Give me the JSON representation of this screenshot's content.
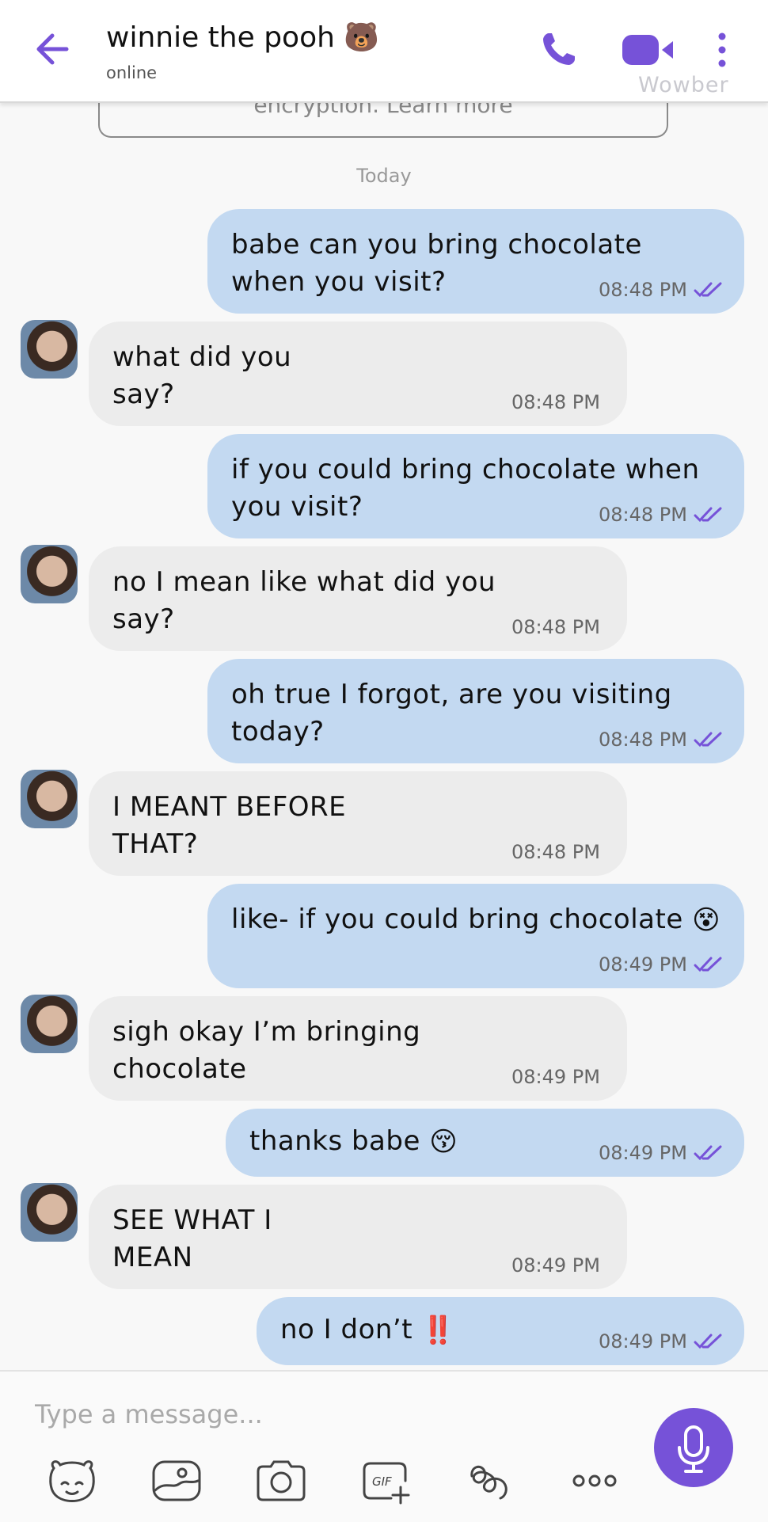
{
  "header": {
    "contact_name": "winnie the pooh 🐻",
    "status": "online",
    "watermark": "Wowber",
    "accent": "#7652d8"
  },
  "chat": {
    "encryption_text": "encryption. Learn more",
    "date_separator": "Today",
    "messages": [
      {
        "dir": "out",
        "text": "babe can you bring chocolate when you visit?",
        "time": "08:48 PM"
      },
      {
        "dir": "in",
        "text": "what did you say?",
        "time": "08:48 PM"
      },
      {
        "dir": "out",
        "text": "if you could bring chocolate when you visit?",
        "time": "08:48 PM"
      },
      {
        "dir": "in",
        "text": "no I mean like what did you say?",
        "time": "08:48 PM"
      },
      {
        "dir": "out",
        "text": "oh true I forgot, are you visiting today?",
        "time": "08:48 PM"
      },
      {
        "dir": "in",
        "text": "I MEANT BEFORE THAT?",
        "time": "08:48 PM"
      },
      {
        "dir": "out",
        "text": "like- if you could bring chocolate",
        "emoji": "😵",
        "time": "08:49 PM"
      },
      {
        "dir": "in",
        "text": "sigh okay I’m bringing chocolate",
        "time": "08:49 PM"
      },
      {
        "dir": "out",
        "text": "thanks babe",
        "emoji": "😚",
        "time": "08:49 PM"
      },
      {
        "dir": "in",
        "text": "SEE WHAT I MEAN",
        "time": "08:49 PM"
      },
      {
        "dir": "out",
        "text": "no I don’t",
        "emoji": "‼️",
        "time": "08:49 PM"
      }
    ]
  },
  "composer": {
    "placeholder": "Type a message...",
    "tools": [
      "sticker-icon",
      "gallery-icon",
      "camera-icon",
      "gif-icon",
      "doodle-icon",
      "more-options-icon"
    ]
  }
}
